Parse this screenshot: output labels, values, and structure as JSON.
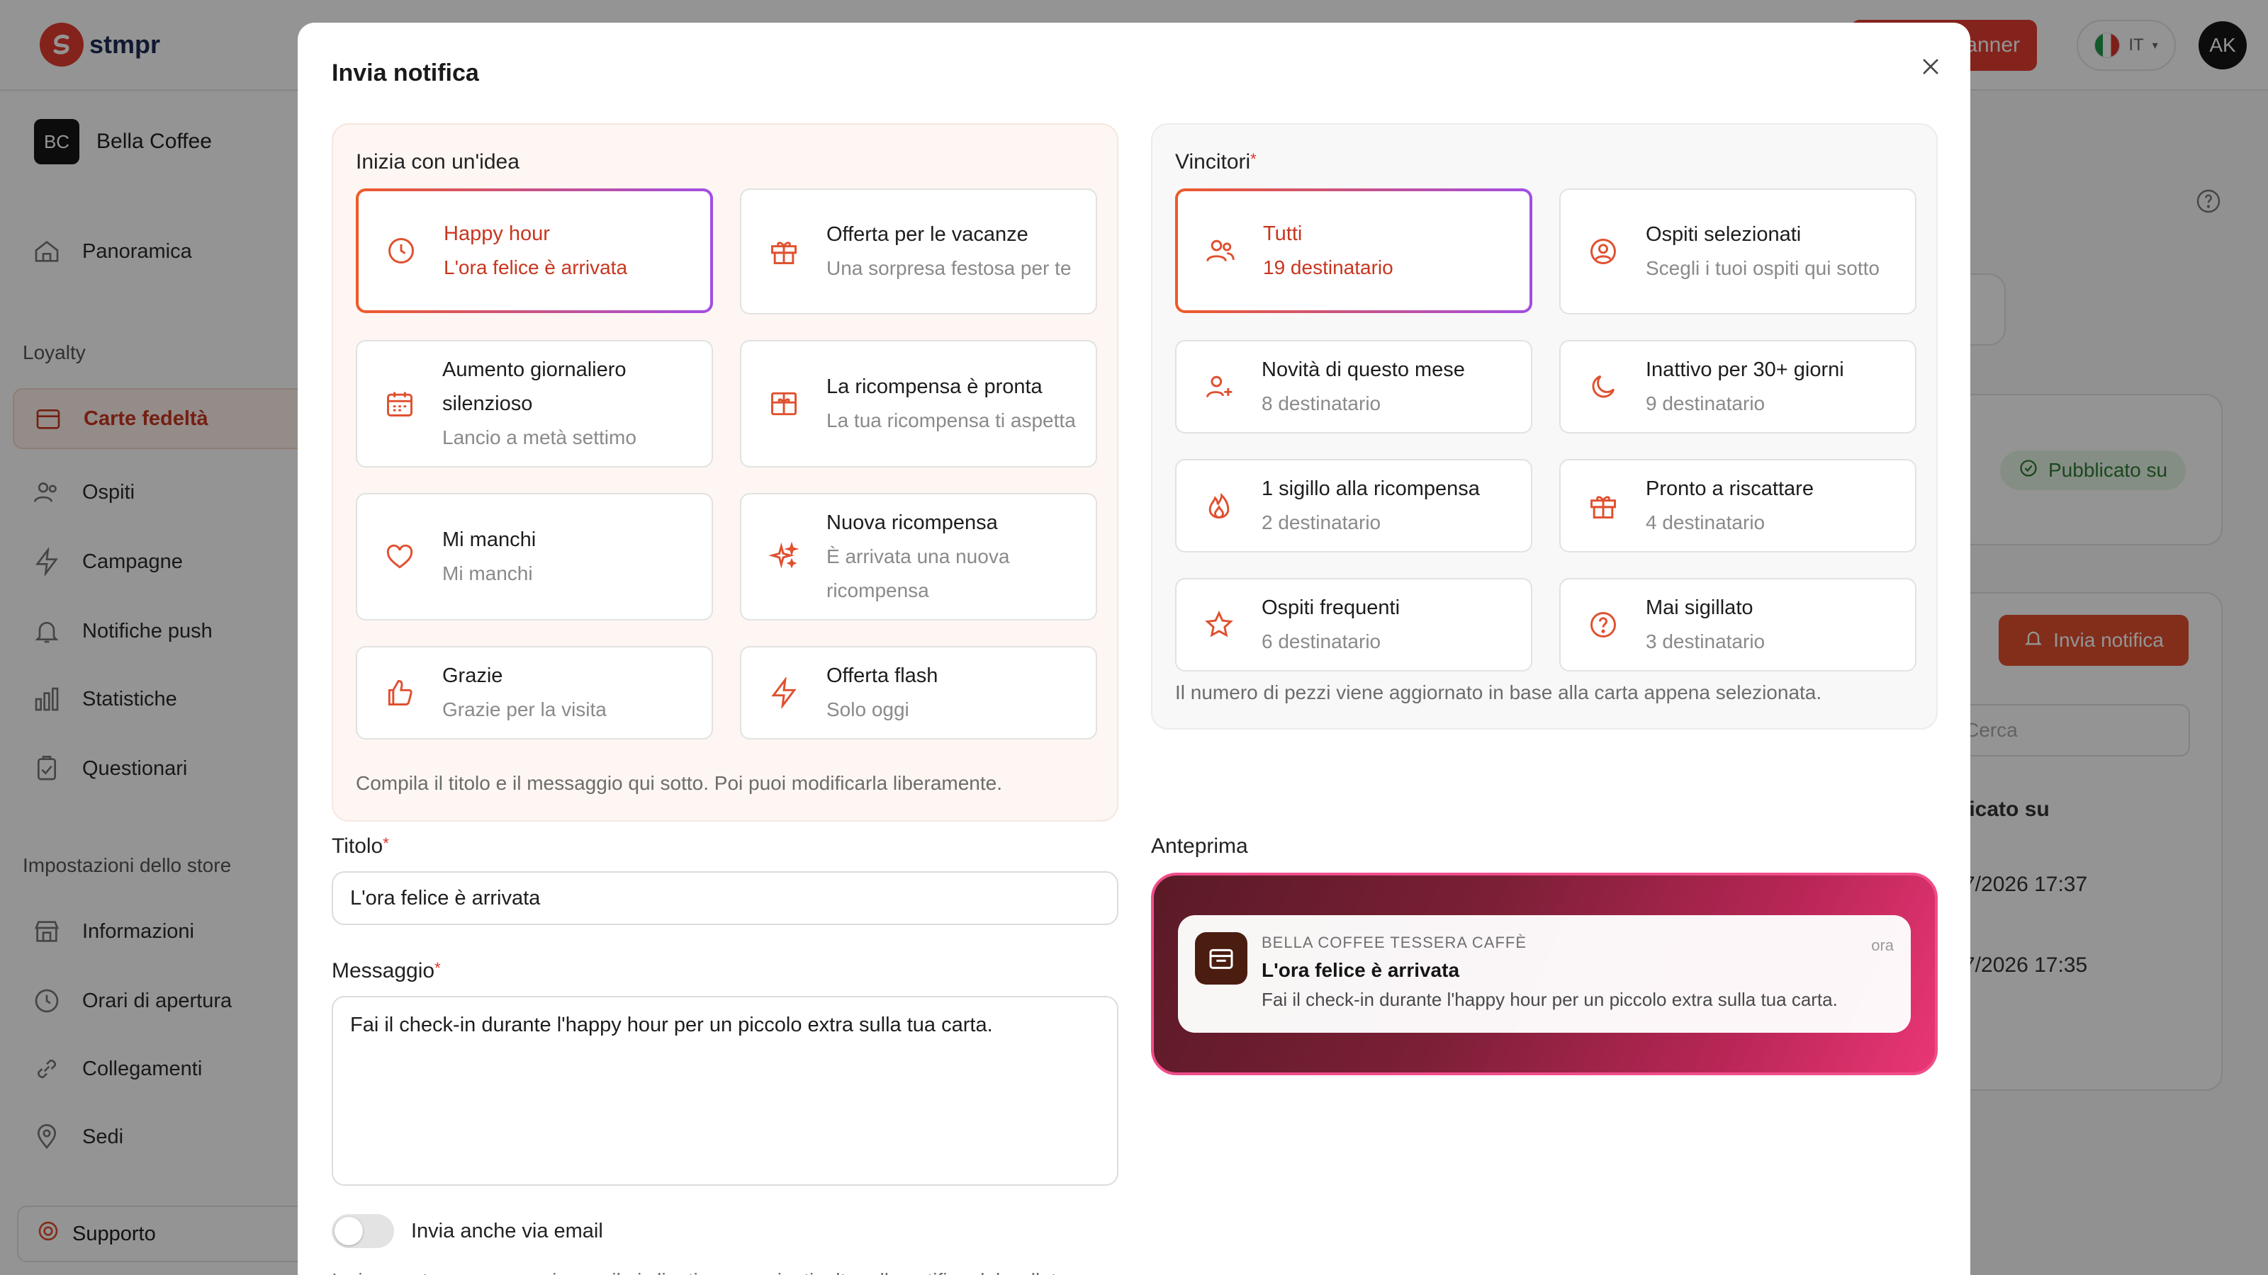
{
  "app": {
    "brand": "stmpr",
    "banner_button": "anner",
    "language": "IT",
    "user_initials": "AK",
    "store_initials": "BC",
    "store_name": "Bella Coffee",
    "nav": {
      "overview": "Panoramica",
      "section_loyalty": "Loyalty",
      "cards": "Carte fedeltà",
      "guests": "Ospiti",
      "campaigns": "Campagne",
      "push": "Notifiche push",
      "stats": "Statistiche",
      "surveys": "Questionari",
      "section_store": "Impostazioni dello store",
      "info": "Informazioni",
      "hours": "Orari di apertura",
      "links": "Collegamenti",
      "locations": "Sedi",
      "support": "Supporto"
    },
    "background": {
      "card_fragment": "a",
      "published_badge": "Pubblicato su",
      "notify_button": "Invia notifica",
      "search_placeholder": "Cerca",
      "column_header": "licato su",
      "row1_date": "7/2026 17:37",
      "row2_date": "7/2026 17:35"
    }
  },
  "modal": {
    "title": "Invia notifica",
    "ideas": {
      "label": "Inizia con un'idea",
      "items": [
        {
          "title": "Happy hour",
          "subtitle": "L'ora felice è arrivata",
          "icon": "clock-icon",
          "selected": true
        },
        {
          "title": "Offerta per le vacanze",
          "subtitle": "Una sorpresa festosa per te",
          "icon": "gift-icon",
          "selected": false
        },
        {
          "title": "Aumento giornaliero silenzioso",
          "subtitle": "Lancio a metà settimo",
          "icon": "calendar-icon",
          "selected": false
        },
        {
          "title": "La ricompensa è pronta",
          "subtitle": "La tua ricompensa ti aspetta",
          "icon": "gift-box-icon",
          "selected": false
        },
        {
          "title": "Mi manchi",
          "subtitle": "Mi manchi",
          "icon": "heart-icon",
          "selected": false
        },
        {
          "title": "Nuova ricompensa",
          "subtitle": "È arrivata una nuova ricompensa",
          "icon": "sparkles-icon",
          "selected": false
        },
        {
          "title": "Grazie",
          "subtitle": "Grazie per la visita",
          "icon": "thumbs-up-icon",
          "selected": false
        },
        {
          "title": "Offerta flash",
          "subtitle": "Solo oggi",
          "icon": "flash-icon",
          "selected": false
        }
      ],
      "hint": "Compila il titolo e il messaggio qui sotto. Poi puoi modificarla liberamente."
    },
    "winners": {
      "label": "Vincitori",
      "items": [
        {
          "title": "Tutti",
          "subtitle": "19 destinatario",
          "icon": "users-icon",
          "selected": true
        },
        {
          "title": "Ospiti selezionati",
          "subtitle": "Scegli i tuoi ospiti qui sotto",
          "icon": "user-circle-icon",
          "selected": false
        },
        {
          "title": "Novità di questo mese",
          "subtitle": "8 destinatario",
          "icon": "user-plus-icon",
          "selected": false
        },
        {
          "title": "Inattivo per 30+ giorni",
          "subtitle": "9 destinatario",
          "icon": "moon-icon",
          "selected": false
        },
        {
          "title": "1 sigillo alla ricompensa",
          "subtitle": "2 destinatario",
          "icon": "flame-icon",
          "selected": false
        },
        {
          "title": "Pronto a riscattare",
          "subtitle": "4 destinatario",
          "icon": "gift-icon",
          "selected": false
        },
        {
          "title": "Ospiti frequenti",
          "subtitle": "6 destinatario",
          "icon": "star-icon",
          "selected": false
        },
        {
          "title": "Mai sigillato",
          "subtitle": "3 destinatario",
          "icon": "question-circle-icon",
          "selected": false
        }
      ],
      "hint": "Il numero di pezzi viene aggiornato in base alla carta appena selezionata."
    },
    "title_field": {
      "label": "Titolo",
      "value": "L'ora felice è arrivata"
    },
    "message_field": {
      "label": "Messaggio",
      "value": "Fai il check-in durante l'happy hour per un piccolo extra sulla tua carta."
    },
    "email_toggle": {
      "label": "Invia anche via email",
      "on": false,
      "description": "Invia questa campagna via email ai clienti consenzienti, oltre alla notifica del wallet."
    },
    "preview": {
      "label": "Anteprima",
      "app_name": "BELLA COFFEE TESSERA CAFFÈ",
      "time": "ora",
      "title": "L'ora felice è arrivata",
      "body": "Fai il check-in durante l'happy hour per un piccolo extra sulla tua carta."
    }
  }
}
